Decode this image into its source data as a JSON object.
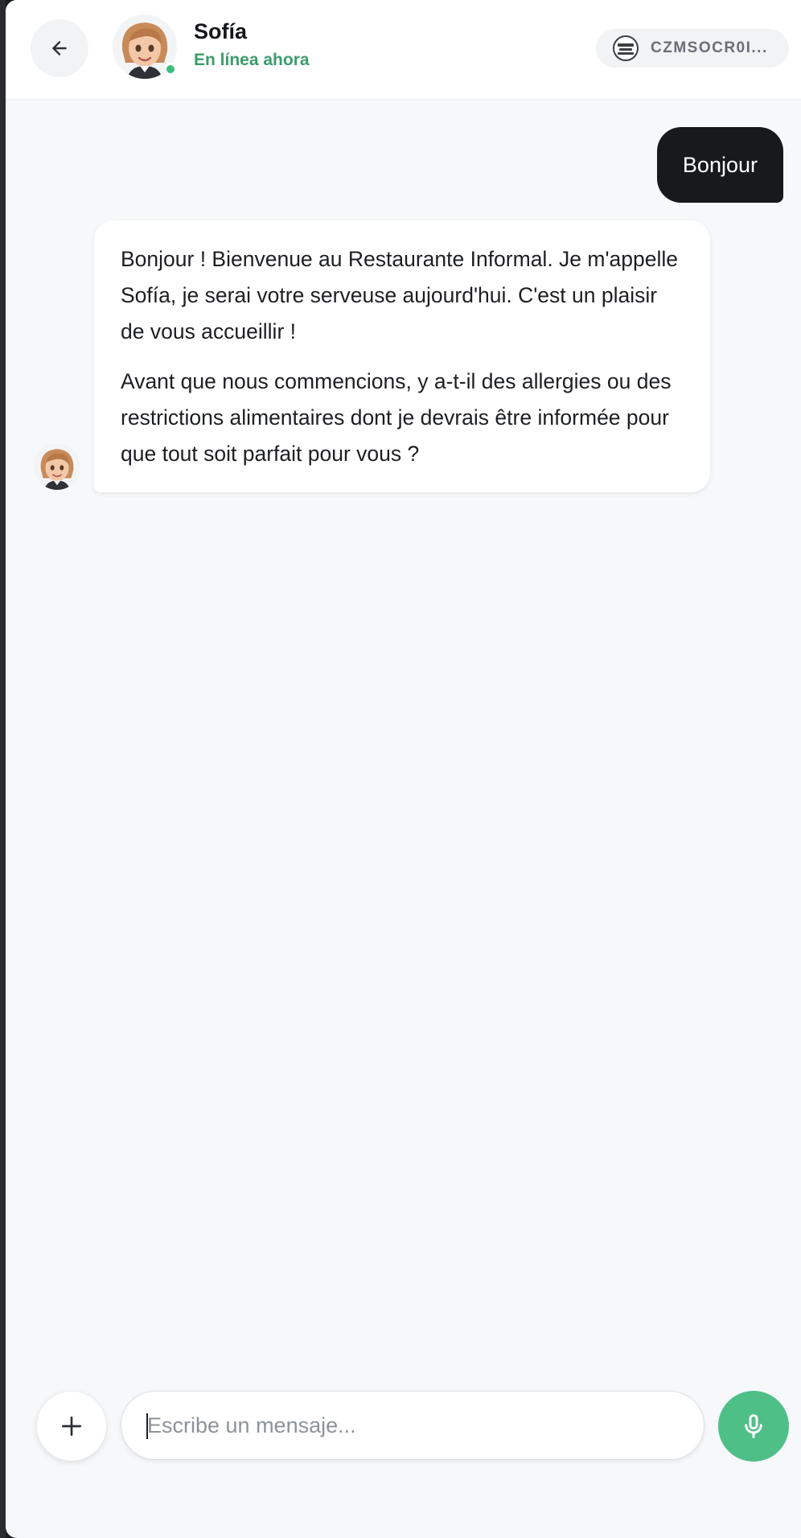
{
  "header": {
    "back_icon": "arrow-left-icon",
    "contact_name": "Sofía",
    "contact_status": "En línea ahora",
    "status_color": "#3a9d6b",
    "restaurant_code": "CZMSOCR0I..."
  },
  "messages": [
    {
      "sender": "user",
      "text": "Bonjour"
    },
    {
      "sender": "bot",
      "paragraphs": [
        "Bonjour ! Bienvenue au Restaurante Informal. Je m'appelle Sofía, je serai votre serveuse aujourd'hui. C'est un plaisir de vous accueillir !",
        "Avant que nous commencions, y a-t-il des allergies ou des restrictions alimentaires dont je devrais être informée pour que tout soit parfait pour vous ?"
      ]
    }
  ],
  "composer": {
    "add_icon": "plus-icon",
    "placeholder": "Escribe un mensaje...",
    "value": "",
    "mic_icon": "microphone-icon",
    "accent_color": "#4fbf88"
  }
}
